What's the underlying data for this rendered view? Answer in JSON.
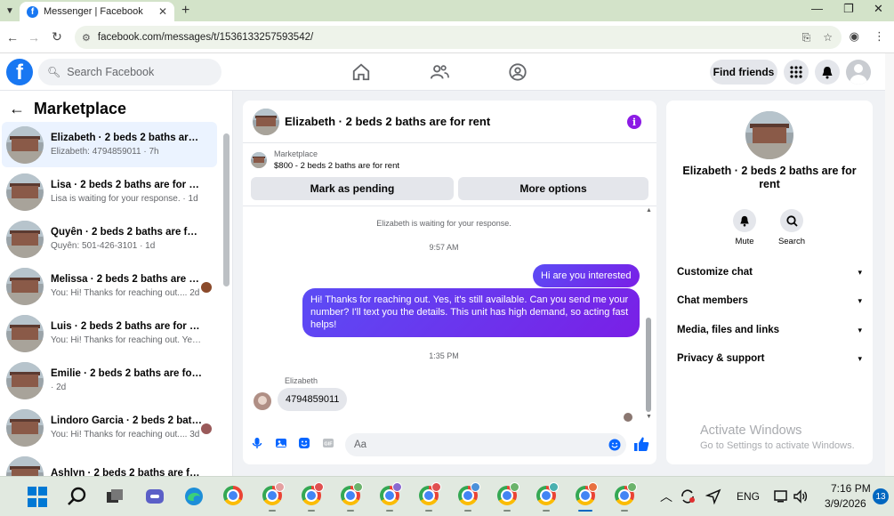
{
  "browser": {
    "tab_title": "Messenger | Facebook",
    "tab_close": "✕",
    "new_tab": "+",
    "url": "facebook.com/messages/t/1536133257593542/"
  },
  "fb_header": {
    "logo": "f",
    "search_placeholder": "Search Facebook",
    "find_friends": "Find friends"
  },
  "left_pane": {
    "title": "Marketplace",
    "conversations": [
      {
        "name": "Elizabeth · 2 beds 2 baths are fo...",
        "preview": "Elizabeth: 4794859011 · 7h",
        "active": true
      },
      {
        "name": "Lisa · 2 beds 2 baths are for rent",
        "preview": "Lisa is waiting for your response. · 1d"
      },
      {
        "name": "Quyên · 2 beds 2 baths are for r...",
        "preview": "Quyên: 501-426-3101 · 1d"
      },
      {
        "name": "Melissa · 2 beds 2 baths are fo...",
        "preview": "You: Hi! Thanks for reaching out.... 2d"
      },
      {
        "name": "Luis · 2 beds 2 baths are for rent",
        "preview": "You: Hi! Thanks for reaching out. Ye... 2d"
      },
      {
        "name": "Emilie · 2 beds 2 baths are for rent",
        "preview": "· 2d"
      },
      {
        "name": "Lindoro Garcia · 2 beds 2 bath...",
        "preview": "You: Hi! Thanks for reaching out.... 3d"
      },
      {
        "name": "Ashlyn · 2 beds 2 baths are for r...",
        "preview": ""
      }
    ]
  },
  "chat": {
    "title": "Elizabeth · 2 beds 2 baths are for rent",
    "marketplace_label": "Marketplace",
    "listing": "$800 - 2 beds 2 baths are for rent",
    "mark_pending": "Mark as pending",
    "more_options": "More options",
    "waiting_note": "Elizabeth is waiting for your response.",
    "time1": "9:57 AM",
    "msg_out_1": "Hi are you interested",
    "msg_out_2": "Hi! Thanks for reaching out. Yes, it's still available. Can you send me your number? I'll text you the details. This unit has high demand, so acting fast helps!",
    "time2": "1:35 PM",
    "sender_name": "Elizabeth",
    "msg_in_1": "4794859011",
    "composer_placeholder": "Aa"
  },
  "right_panel": {
    "title": "Elizabeth · 2 beds 2 baths are for rent",
    "mute": "Mute",
    "search": "Search",
    "rows": [
      "Customize chat",
      "Chat members",
      "Media, files and links",
      "Privacy & support"
    ]
  },
  "watermark": {
    "line1": "Activate Windows",
    "line2": "Go to Settings to activate Windows."
  },
  "taskbar": {
    "lang": "ENG",
    "time": "7:16 PM",
    "date": "3/9/2026",
    "notifications": "13"
  },
  "colors": {
    "fb_blue": "#1877f2",
    "messenger_blue": "#0866ff",
    "bubble_purple": "#7a1fe6",
    "active_row": "#ebf3ff"
  }
}
